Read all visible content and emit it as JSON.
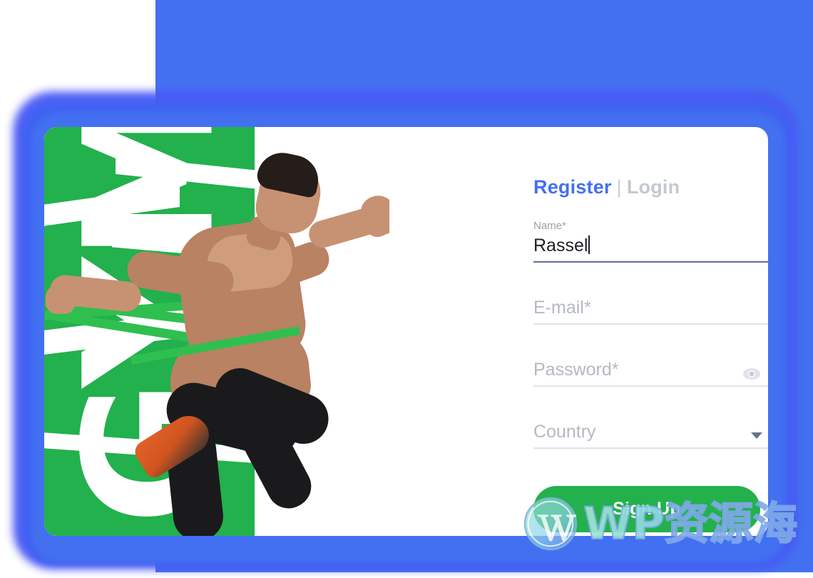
{
  "brand": {
    "accent_blue": "#4370f0",
    "accent_green": "#22b14c",
    "panel_word": "GYM"
  },
  "tabs": {
    "register_label": "Register",
    "separator": "|",
    "login_label": "Login"
  },
  "form": {
    "name": {
      "label": "Name*",
      "value": "Rassel"
    },
    "email": {
      "placeholder": "E-mail*",
      "value": ""
    },
    "password": {
      "placeholder": "Password*",
      "value": "",
      "toggle_icon": "eye-icon"
    },
    "country": {
      "placeholder": "Country",
      "value": "",
      "dropdown_icon": "chevron-down-icon"
    },
    "submit_label": "Sign Up"
  },
  "watermark": {
    "logo_icon": "wordpress-logo-icon",
    "text": "WP资源海"
  }
}
